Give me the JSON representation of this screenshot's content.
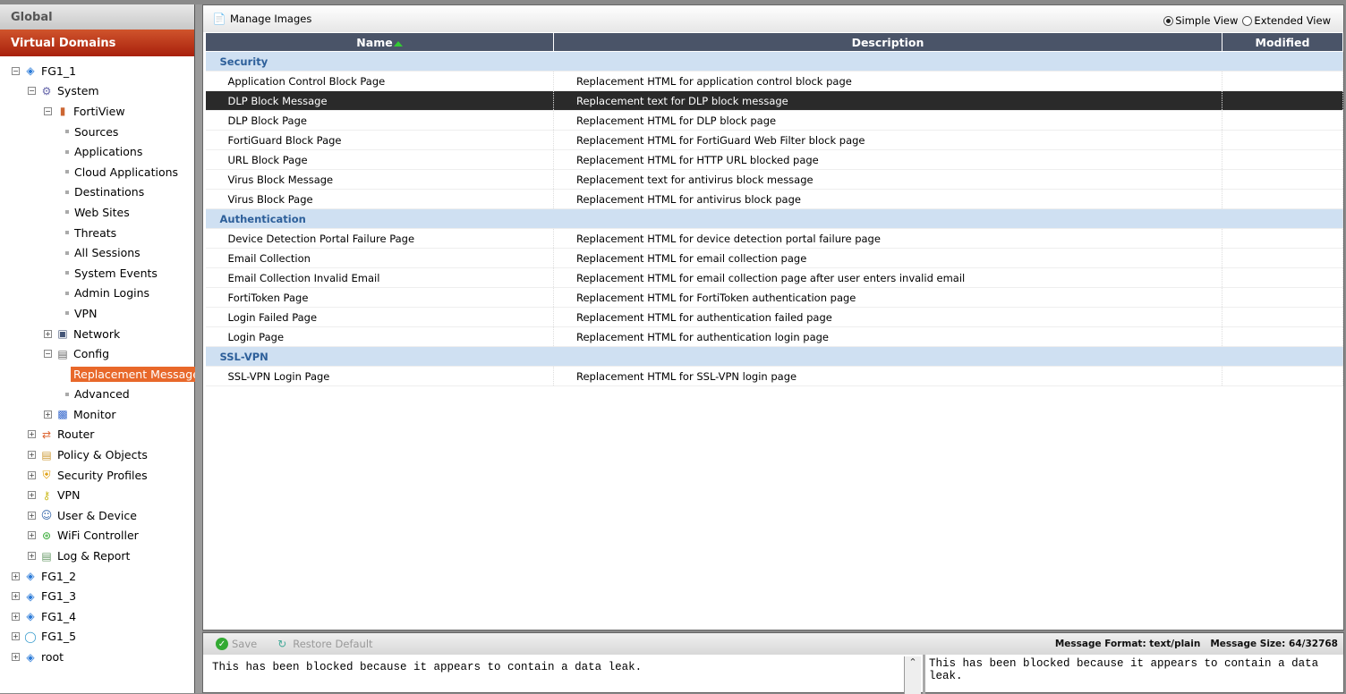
{
  "sidebar": {
    "global": "Global",
    "vdom": "Virtual Domains",
    "tree": [
      {
        "label": "FG1_1",
        "level": 0,
        "pm": "-",
        "icon": "vdom-icon"
      },
      {
        "label": "System",
        "level": 1,
        "pm": "-",
        "icon": "gear-icon"
      },
      {
        "label": "FortiView",
        "level": 2,
        "pm": "-",
        "icon": "bar-chart-icon"
      },
      {
        "label": "Sources",
        "level": 3
      },
      {
        "label": "Applications",
        "level": 3
      },
      {
        "label": "Cloud Applications",
        "level": 3
      },
      {
        "label": "Destinations",
        "level": 3
      },
      {
        "label": "Web Sites",
        "level": 3
      },
      {
        "label": "Threats",
        "level": 3
      },
      {
        "label": "All Sessions",
        "level": 3
      },
      {
        "label": "System Events",
        "level": 3
      },
      {
        "label": "Admin Logins",
        "level": 3
      },
      {
        "label": "VPN",
        "level": 3
      },
      {
        "label": "Network",
        "level": 2,
        "pm": "+",
        "icon": "network-icon"
      },
      {
        "label": "Config",
        "level": 2,
        "pm": "-",
        "icon": "config-icon"
      },
      {
        "label": "Replacement Messages",
        "level": 3,
        "selected": true
      },
      {
        "label": "Advanced",
        "level": 3
      },
      {
        "label": "Monitor",
        "level": 2,
        "pm": "+",
        "icon": "monitor-icon"
      },
      {
        "label": "Router",
        "level": 1,
        "pm": "+",
        "icon": "router-icon"
      },
      {
        "label": "Policy & Objects",
        "level": 1,
        "pm": "+",
        "icon": "policy-icon"
      },
      {
        "label": "Security Profiles",
        "level": 1,
        "pm": "+",
        "icon": "shield-icon"
      },
      {
        "label": "VPN",
        "level": 1,
        "pm": "+",
        "icon": "key-icon"
      },
      {
        "label": "User & Device",
        "level": 1,
        "pm": "+",
        "icon": "user-icon"
      },
      {
        "label": "WiFi Controller",
        "level": 1,
        "pm": "+",
        "icon": "wifi-icon"
      },
      {
        "label": "Log & Report",
        "level": 1,
        "pm": "+",
        "icon": "log-icon"
      },
      {
        "label": "FG1_2",
        "level": 0,
        "pm": "+",
        "icon": "vdom-icon"
      },
      {
        "label": "FG1_3",
        "level": 0,
        "pm": "+",
        "icon": "vdom-icon"
      },
      {
        "label": "FG1_4",
        "level": 0,
        "pm": "+",
        "icon": "vdom-icon"
      },
      {
        "label": "FG1_5",
        "level": 0,
        "pm": "+",
        "icon": "globe-icon"
      },
      {
        "label": "root",
        "level": 0,
        "pm": "+",
        "icon": "vdom-icon"
      }
    ]
  },
  "toolbar": {
    "manage_images": "Manage Images",
    "simple_view": "Simple View",
    "extended_view": "Extended View",
    "view": "simple"
  },
  "table": {
    "headers": [
      "Name",
      "Description",
      "Modified"
    ],
    "groups": [
      {
        "name": "Security",
        "rows": [
          [
            "Application Control Block Page",
            "Replacement HTML for application control block page",
            ""
          ],
          [
            "DLP Block Message",
            "Replacement text for DLP block message",
            ""
          ],
          [
            "DLP Block Page",
            "Replacement HTML for DLP block page",
            ""
          ],
          [
            "FortiGuard Block Page",
            "Replacement HTML for FortiGuard Web Filter block page",
            ""
          ],
          [
            "URL Block Page",
            "Replacement HTML for HTTP URL blocked page",
            ""
          ],
          [
            "Virus Block Message",
            "Replacement text for antivirus block message",
            ""
          ],
          [
            "Virus Block Page",
            "Replacement HTML for antivirus block page",
            ""
          ]
        ]
      },
      {
        "name": "Authentication",
        "rows": [
          [
            "Device Detection Portal Failure Page",
            "Replacement HTML for device detection portal failure page",
            ""
          ],
          [
            "Email Collection",
            "Replacement HTML for email collection page",
            ""
          ],
          [
            "Email Collection Invalid Email",
            "Replacement HTML for email collection page after user enters invalid email",
            ""
          ],
          [
            "FortiToken Page",
            "Replacement HTML for FortiToken authentication page",
            ""
          ],
          [
            "Login Failed Page",
            "Replacement HTML for authentication failed page",
            ""
          ],
          [
            "Login Page",
            "Replacement HTML for authentication login page",
            ""
          ]
        ]
      },
      {
        "name": "SSL-VPN",
        "rows": [
          [
            "SSL-VPN Login Page",
            "Replacement HTML for SSL-VPN login page",
            ""
          ]
        ]
      }
    ],
    "selected": "DLP Block Message"
  },
  "editor": {
    "save": "Save",
    "restore": "Restore Default",
    "format": "Message Format: text/plain",
    "size": "Message Size: 64/32768",
    "text": "This has been blocked because it appears to contain a data leak.",
    "preview": "This has been blocked because it appears to contain a data leak."
  }
}
